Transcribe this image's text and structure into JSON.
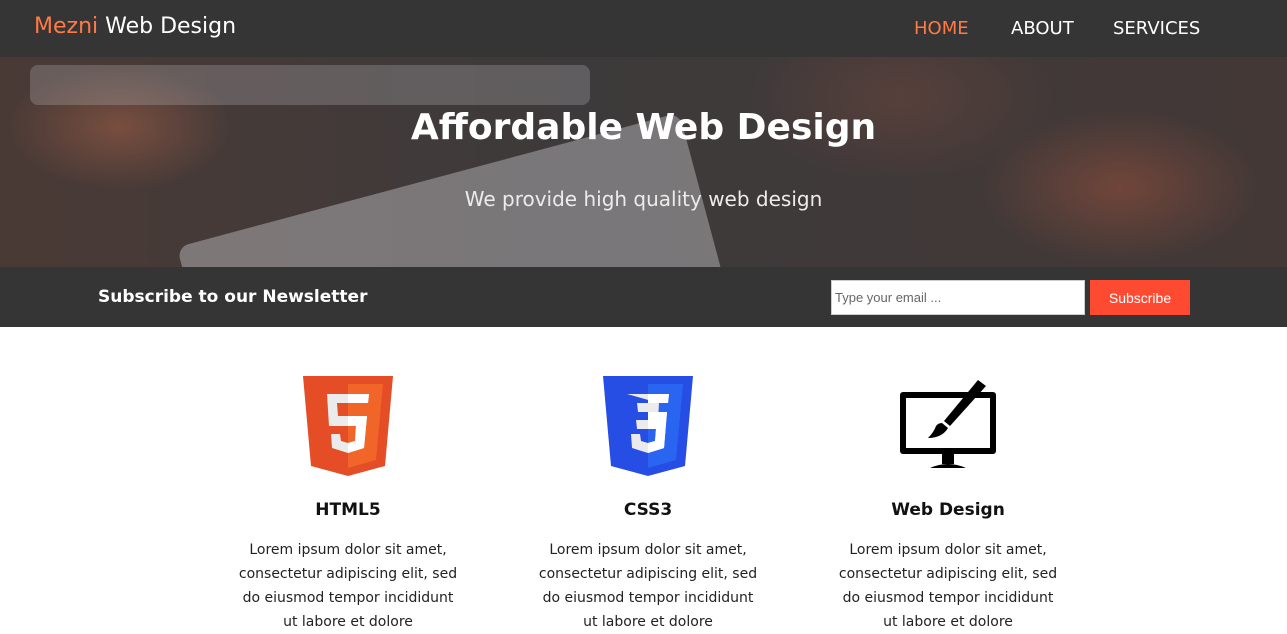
{
  "header": {
    "brand_highlight": "Mezni",
    "brand_rest": " Web Design",
    "nav": [
      {
        "label": "HOME",
        "active": true
      },
      {
        "label": "ABOUT",
        "active": false
      },
      {
        "label": "SERVICES",
        "active": false
      }
    ],
    "accent_color": "#ff7a45"
  },
  "hero": {
    "title": "Affordable Web Design",
    "subtitle": "We provide high quality web design"
  },
  "newsletter": {
    "title": "Subscribe to our Newsletter",
    "email_placeholder": "Type your email ...",
    "email_value": "",
    "button_label": "Subscribe",
    "button_color": "#ff4a32"
  },
  "features": [
    {
      "icon": "html5-logo-icon",
      "title": "HTML5",
      "text": "Lorem ipsum dolor sit amet, consectetur adipiscing elit, sed do eiusmod tempor incididunt ut labore et dolore"
    },
    {
      "icon": "css3-logo-icon",
      "title": "CSS3",
      "text": "Lorem ipsum dolor sit amet, consectetur adipiscing elit, sed do eiusmod tempor incididunt ut labore et dolore"
    },
    {
      "icon": "web-design-monitor-icon",
      "title": "Web Design",
      "text": "Lorem ipsum dolor sit amet, consectetur adipiscing elit, sed do eiusmod tempor incididunt ut labore et dolore"
    }
  ]
}
